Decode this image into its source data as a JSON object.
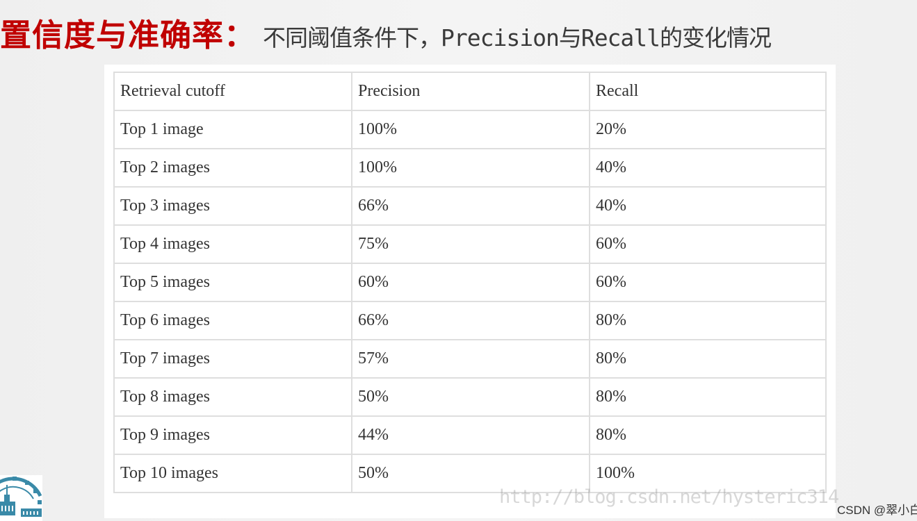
{
  "slide": {
    "title_main": "置信度与准确率：",
    "title_sub": "不同阈值条件下，Precision与Recall的变化情况",
    "accent_color": "#c00000"
  },
  "table": {
    "headers": [
      "Retrieval cutoff",
      "Precision",
      "Recall"
    ],
    "rows": [
      [
        "Top 1 image",
        "100%",
        "20%"
      ],
      [
        "Top 2 images",
        "100%",
        "40%"
      ],
      [
        "Top 3 images",
        "66%",
        "40%"
      ],
      [
        "Top 4 images",
        "75%",
        "60%"
      ],
      [
        "Top 5 images",
        "60%",
        "60%"
      ],
      [
        "Top 6 images",
        "66%",
        "80%"
      ],
      [
        "Top 7 images",
        "57%",
        "80%"
      ],
      [
        "Top 8 images",
        "50%",
        "80%"
      ],
      [
        "Top 9 images",
        "44%",
        "80%"
      ],
      [
        "Top 10 images",
        "50%",
        "100%"
      ]
    ]
  },
  "watermark": "http://blog.csdn.net/hysteric314",
  "credit": "CSDN @翠小白",
  "logo": {
    "icon": "university-gear-building-logo"
  }
}
